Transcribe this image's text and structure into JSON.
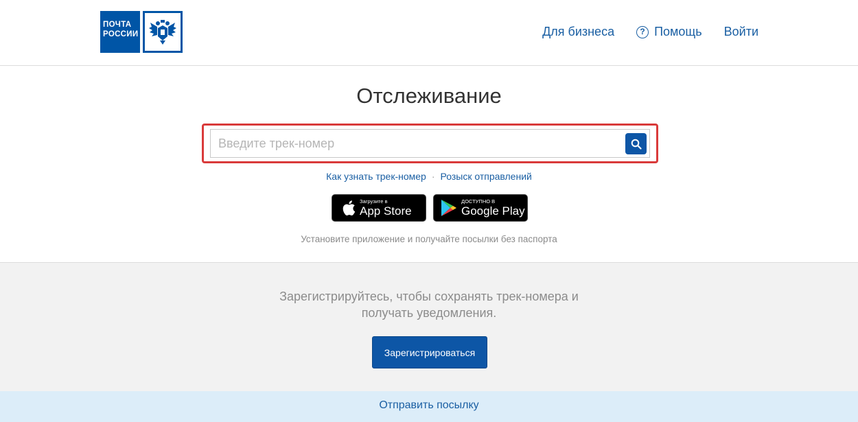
{
  "logo": {
    "line1": "ПОЧТА",
    "line2": "РОССИИ",
    "emblem_icon": "double-headed-eagle-icon",
    "brand_color": "#0055a6"
  },
  "nav": {
    "business": "Для бизнеса",
    "help": "Помощь",
    "help_icon": "question-circle-icon",
    "login": "Войти"
  },
  "tracking": {
    "title": "Отслеживание",
    "placeholder": "Введите трек-номер",
    "value": "",
    "search_icon": "search-icon",
    "link_how": "Как узнать трек-номер",
    "link_separator": "·",
    "link_search": "Розыск отправлений",
    "install_note": "Установите приложение и получайте посылки без паспорта"
  },
  "badges": {
    "appstore_small": "Загрузите в",
    "appstore_big": "App Store",
    "gplay_small": "ДОСТУПНО В",
    "gplay_big": "Google Play"
  },
  "register": {
    "text_line1": "Зарегистрируйтесь, чтобы сохранять трек-номера и",
    "text_line2": "получать уведомления.",
    "button": "Зарегистрироваться"
  },
  "footer": {
    "send": "Отправить посылку"
  },
  "colors": {
    "link": "#1a5fa3",
    "primary_button": "#0d56a6",
    "highlight_border": "#d93a3a",
    "send_bar": "#dcedf9"
  }
}
